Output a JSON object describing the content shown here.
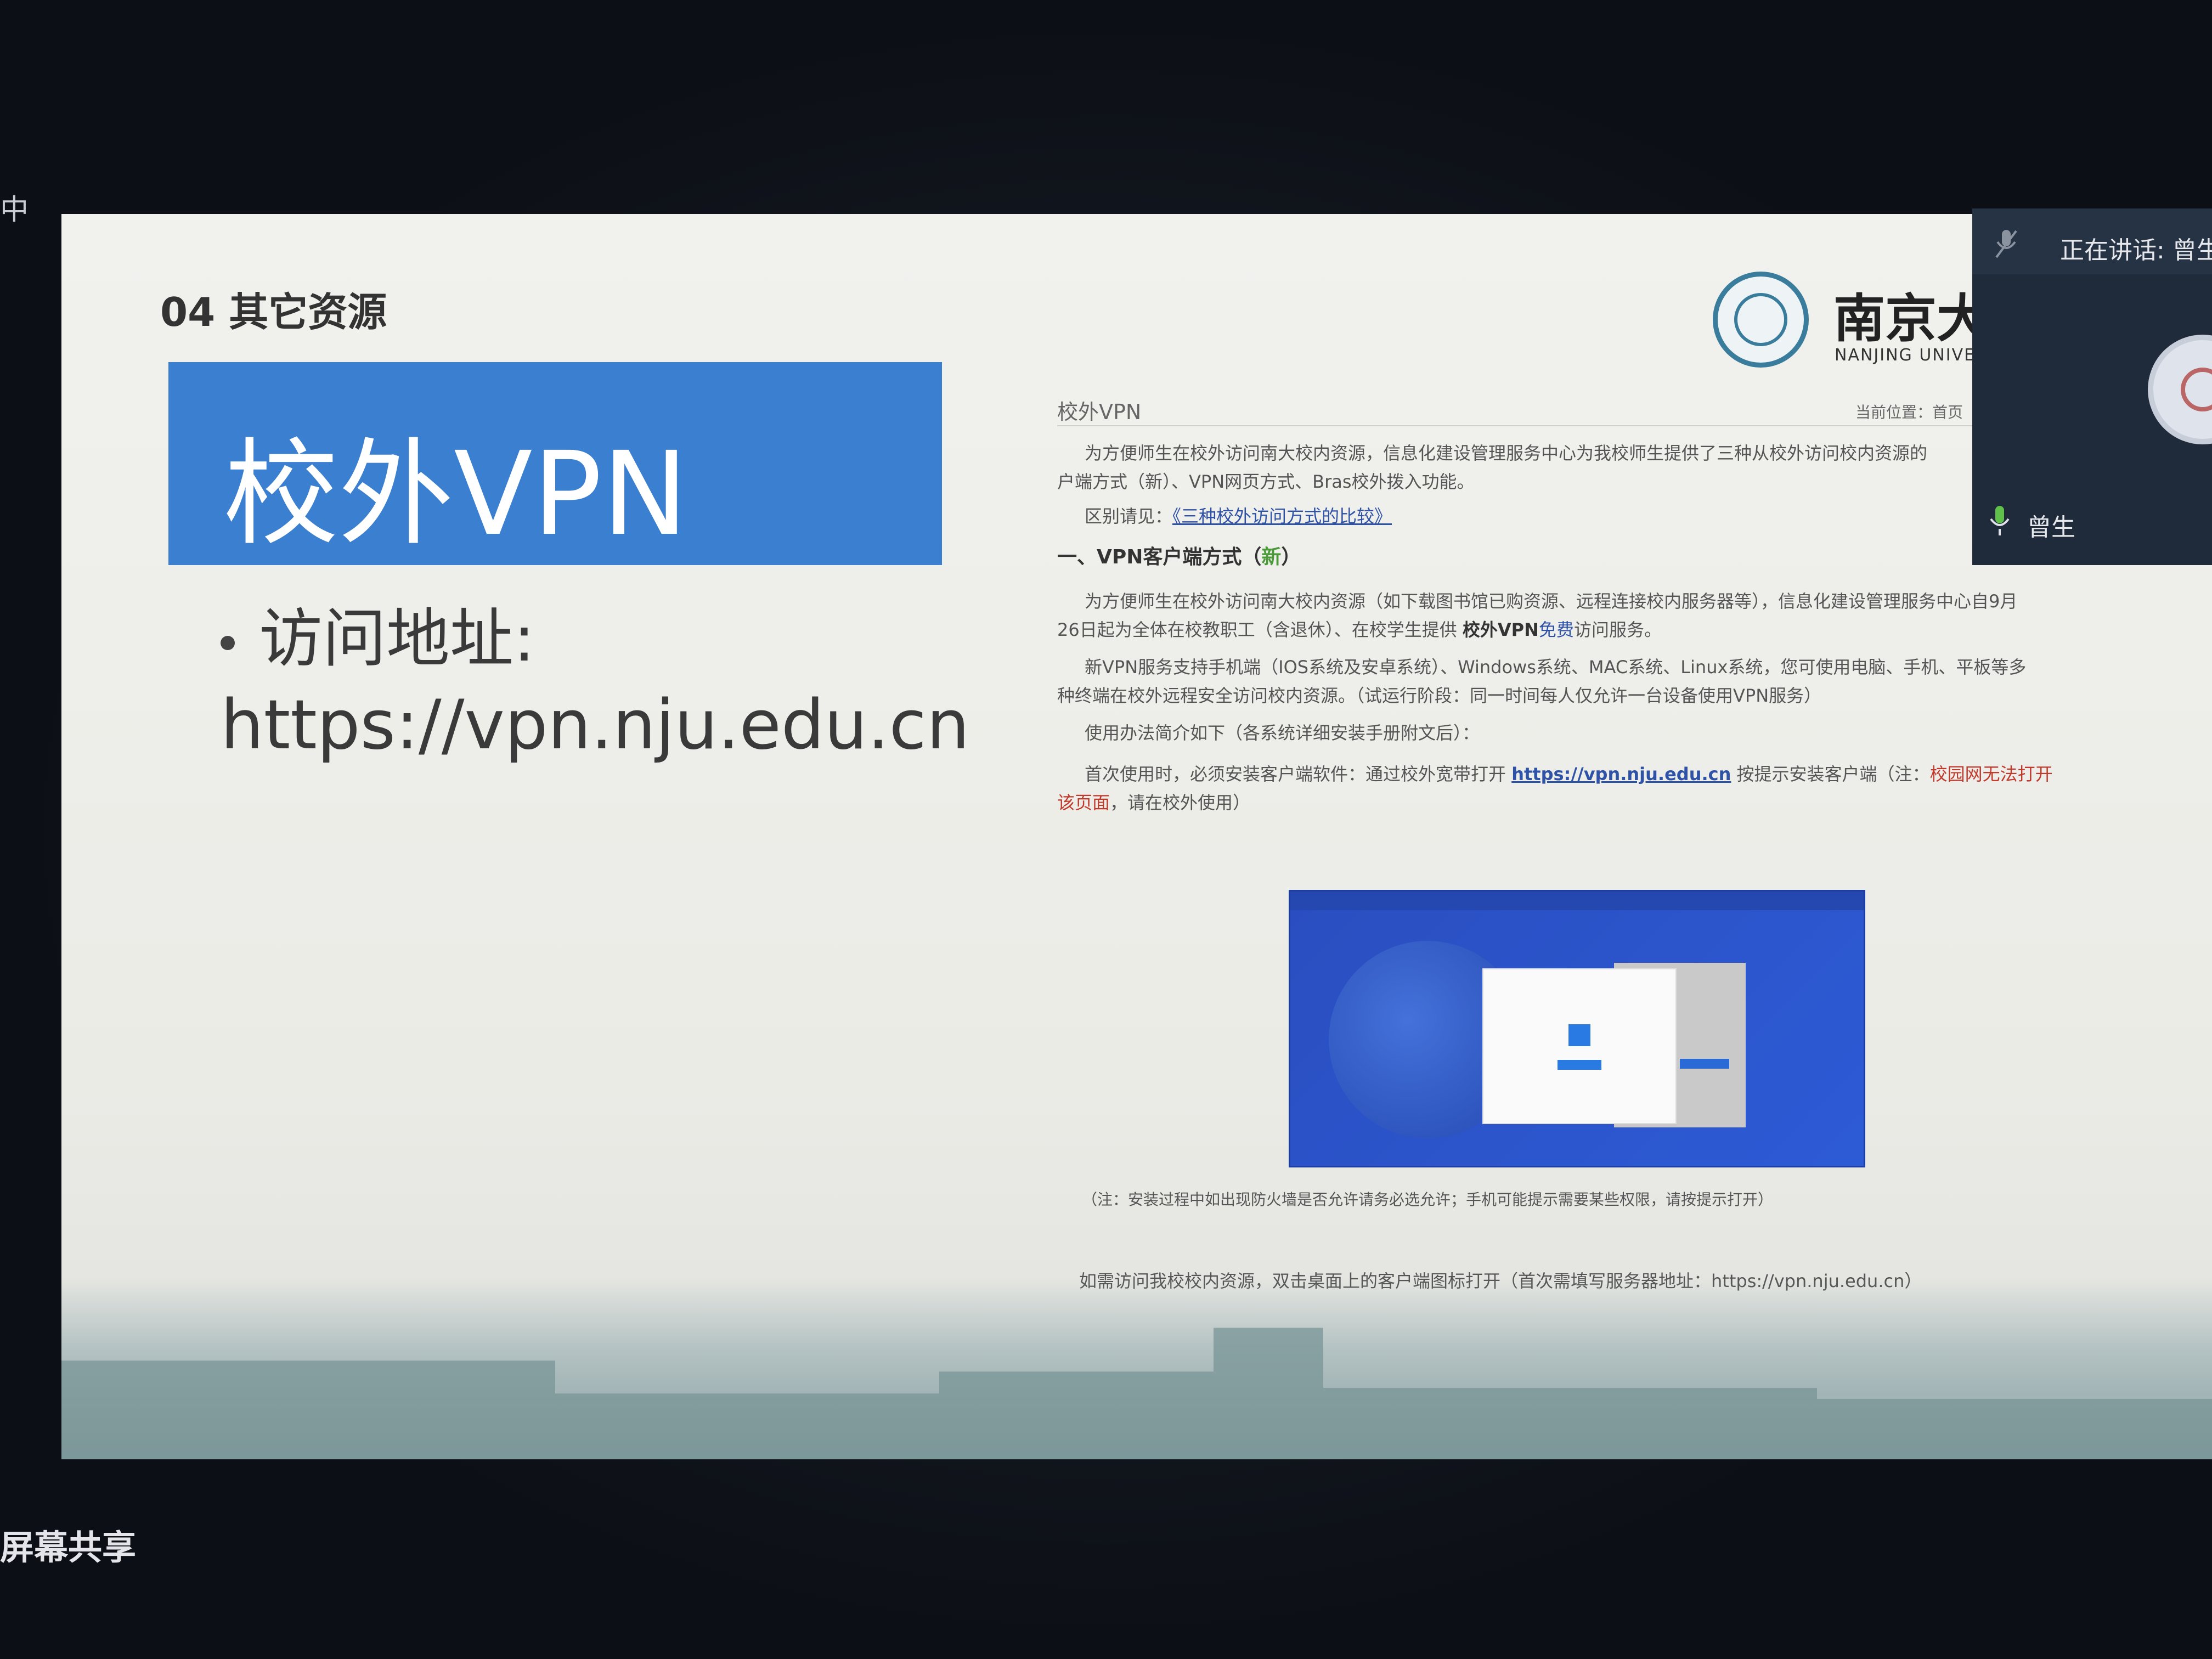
{
  "edge_char": "中",
  "share_label": "屏幕共享",
  "slide": {
    "section_title": "04 其它资源",
    "title": "校外VPN",
    "bullet": "访问地址:",
    "url": "https://vpn.nju.edu.cn",
    "logo_cn": "南京大",
    "logo_en": "NANJING UNIVER"
  },
  "web": {
    "title": "校外VPN",
    "breadcrumb": "当前位置：首页",
    "intro_1": "为方便师生在校外访问南大校内资源，信息化建设管理服务中心为我校师生提供了三种从校外访问校内资源的",
    "intro_2": "户端方式（新）、VPN网页方式、Bras校外拨入功能。",
    "compare_prefix": "区别请见：",
    "compare_link": "《三种校外访问方式的比较》",
    "section_heading": "一、VPN客户端方式（",
    "section_new": "新",
    "section_close": "）",
    "p1_a": "为方便师生在校外访问南大校内资源（如下载图书馆已购资源、远程连接校内服务器等），信息化建设管理服务中心自9月",
    "p1_b_1": "26日起为全体在校教职工（含退休）、在校学生提供 ",
    "p1_b_bold": "校外VPN",
    "p1_b_blue": "免费",
    "p1_b_2": "访问服务。",
    "p2_a": "新VPN服务支持手机端（IOS系统及安卓系统）、Windows系统、MAC系统、Linux系统，您可使用电脑、手机、平板等多",
    "p2_b": "种终端在校外远程安全访问校内资源。（试运行阶段：同一时间每人仅允许一台设备使用VPN服务）",
    "p3": "使用办法简介如下（各系统详细安装手册附文后）：",
    "p4_a": "首次使用时，必须安装客户端软件：通过校外宽带打开 ",
    "p4_link": "https://vpn.nju.edu.cn",
    "p4_b": " 按提示安装客户端（注：",
    "p4_red": "校园网无法打开",
    "p4_red2": "该页面",
    "p4_c": "，请在校外使用）",
    "note": "（注：安装过程中如出现防火墙是否允许请务必选允许；手机可能提示需要某些权限，请按提示打开）",
    "footer": "如需访问我校校内资源，双击桌面上的客户端图标打开（首次需填写服务器地址：https://vpn.nju.edu.cn）"
  },
  "meeting": {
    "speaking_text": "正在讲话: 曾生",
    "participant_name": "曾生"
  },
  "colors": {
    "title_box": "#3b7fd0",
    "link": "#2e52a6",
    "warning": "#c0392b",
    "new_green": "#4a9a3a"
  }
}
